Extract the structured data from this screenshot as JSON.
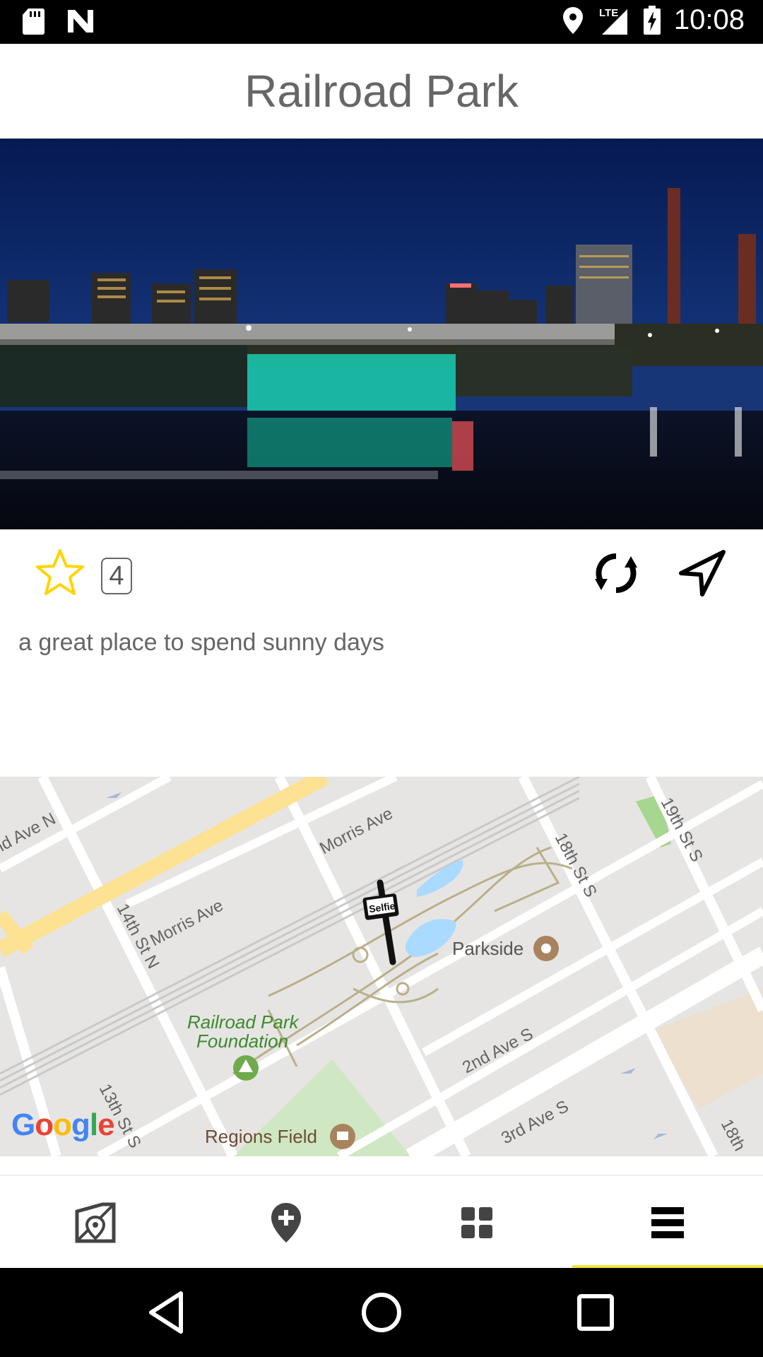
{
  "status_bar": {
    "time": "10:08",
    "network": "LTE",
    "icons": [
      "sd-card-icon",
      "n-icon",
      "location-icon",
      "signal-icon",
      "battery-charging-icon"
    ]
  },
  "header": {
    "title": "Railroad Park"
  },
  "hero": {
    "icon": "photo"
  },
  "actions": {
    "favorite_icon": "star-icon",
    "count": "4",
    "refresh_icon": "refresh-icon",
    "navigate_icon": "navigation-arrow-icon"
  },
  "description": "a great place to spend sunny days",
  "map": {
    "streets": {
      "ave_n_partial": "nd Ave N",
      "morris_ave_top": "Morris Ave",
      "morris_ave_left": "Morris Ave",
      "fourteenth": "14th St N",
      "eighteenth": "18th St S",
      "nineteenth": "19th St S",
      "second_ave": "2nd Ave S",
      "third_ave": "3rd Ave S",
      "thirteenth": "13th St S",
      "eighteenth_partial": "18th"
    },
    "places": {
      "parkside": "Parkside",
      "foundation_line1": "Railroad Park",
      "foundation_line2": "Foundation",
      "regions_field": "Regions Field"
    },
    "marker_label": "Selfie!",
    "attribution": "Google",
    "colors": {
      "highway": "#fde293",
      "park": "#cfe7c3",
      "water": "#aadaff",
      "path": "#b9b08a"
    }
  },
  "bottom_nav": {
    "items": [
      {
        "icon": "map-location-icon"
      },
      {
        "icon": "add-location-icon"
      },
      {
        "icon": "grid-icon"
      },
      {
        "icon": "menu-icon"
      }
    ],
    "active_index": 3,
    "active_color": "#f5e23a"
  },
  "system_nav": {
    "icons": [
      "back-icon",
      "home-icon",
      "recents-icon"
    ]
  }
}
